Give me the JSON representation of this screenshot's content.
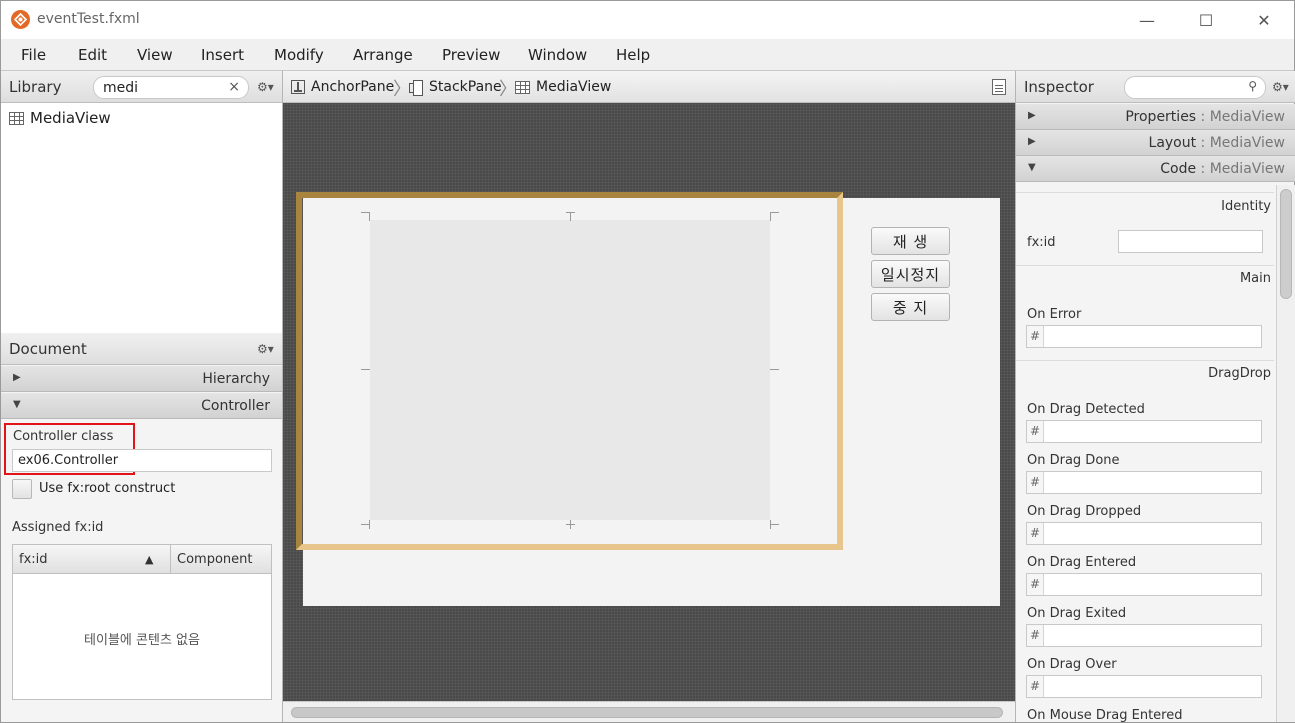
{
  "window": {
    "title": "eventTest.fxml",
    "controls": {
      "minimize": "—",
      "maximize": "☐",
      "close": "✕"
    }
  },
  "menu": [
    "File",
    "Edit",
    "View",
    "Insert",
    "Modify",
    "Arrange",
    "Preview",
    "Window",
    "Help"
  ],
  "library": {
    "title": "Library",
    "search_value": "medi",
    "clear_icon": "×",
    "gear_icon": "⚙▾",
    "items": [
      "MediaView"
    ]
  },
  "document": {
    "title": "Document",
    "gear_icon": "⚙▾",
    "sections": [
      {
        "label": "Hierarchy",
        "expanded": false
      },
      {
        "label": "Controller",
        "expanded": true
      }
    ],
    "controller_class_label": "Controller class",
    "controller_class_value": "ex06.Controller",
    "use_root_label": "Use fx:root construct",
    "assigned_label": "Assigned fx:id",
    "table": {
      "columns": [
        "fx:id",
        "Component"
      ],
      "sort_indicator": "▲",
      "empty_message": "테이블에 콘텐츠 없음"
    }
  },
  "breadcrumb": [
    "AnchorPane",
    "StackPane",
    "MediaView"
  ],
  "canvas": {
    "buttons": [
      "재    생",
      "일시정지",
      "중    지"
    ]
  },
  "inspector": {
    "title": "Inspector",
    "gear_icon": "⚙▾",
    "search_icon": "🔍",
    "sections": [
      {
        "label": "Properties",
        "sub": " : MediaView",
        "expanded": false
      },
      {
        "label": "Layout",
        "sub": " : MediaView",
        "expanded": false
      },
      {
        "label": "Code",
        "sub": " : MediaView",
        "expanded": true
      }
    ],
    "code": {
      "identity_title": "Identity",
      "fxid_label": "fx:id",
      "main_title": "Main",
      "on_error_label": "On Error",
      "dragdrop_title": "DragDrop",
      "dragdrop_fields": [
        "On Drag Detected",
        "On Drag Done",
        "On Drag Dropped",
        "On Drag Entered",
        "On Drag Exited",
        "On Drag Over",
        "On Mouse Drag Entered"
      ],
      "hash": "#"
    }
  }
}
